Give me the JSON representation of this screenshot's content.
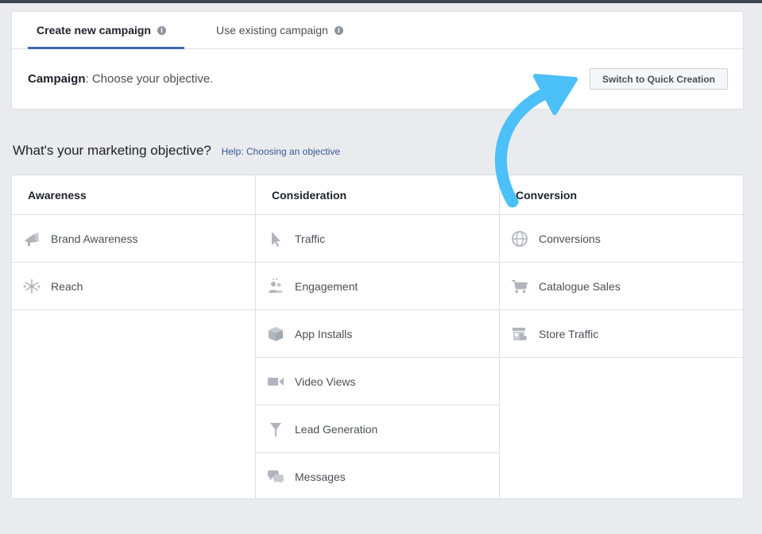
{
  "tabs": [
    {
      "label": "Create new campaign",
      "active": true
    },
    {
      "label": "Use existing campaign",
      "active": false
    }
  ],
  "campaign": {
    "prefix": "Campaign",
    "text": ": Choose your objective."
  },
  "quick_creation_button": "Switch to Quick Creation",
  "question": "What's your marketing objective?",
  "help_link": "Help: Choosing an objective",
  "columns": [
    {
      "heading": "Awareness",
      "items": [
        {
          "label": "Brand Awareness",
          "icon": "megaphone-icon"
        },
        {
          "label": "Reach",
          "icon": "reach-icon"
        }
      ]
    },
    {
      "heading": "Consideration",
      "items": [
        {
          "label": "Traffic",
          "icon": "cursor-icon"
        },
        {
          "label": "Engagement",
          "icon": "people-icon"
        },
        {
          "label": "App Installs",
          "icon": "box-icon"
        },
        {
          "label": "Video Views",
          "icon": "video-camera-icon"
        },
        {
          "label": "Lead Generation",
          "icon": "funnel-icon"
        },
        {
          "label": "Messages",
          "icon": "chat-bubbles-icon"
        }
      ]
    },
    {
      "heading": "Conversion",
      "items": [
        {
          "label": "Conversions",
          "icon": "globe-icon"
        },
        {
          "label": "Catalogue Sales",
          "icon": "shopping-cart-icon"
        },
        {
          "label": "Store Traffic",
          "icon": "store-icon"
        }
      ]
    }
  ],
  "colors": {
    "accent": "#4267b2",
    "arrow": "#4cc0f8",
    "icon": "#b0b5bd"
  }
}
